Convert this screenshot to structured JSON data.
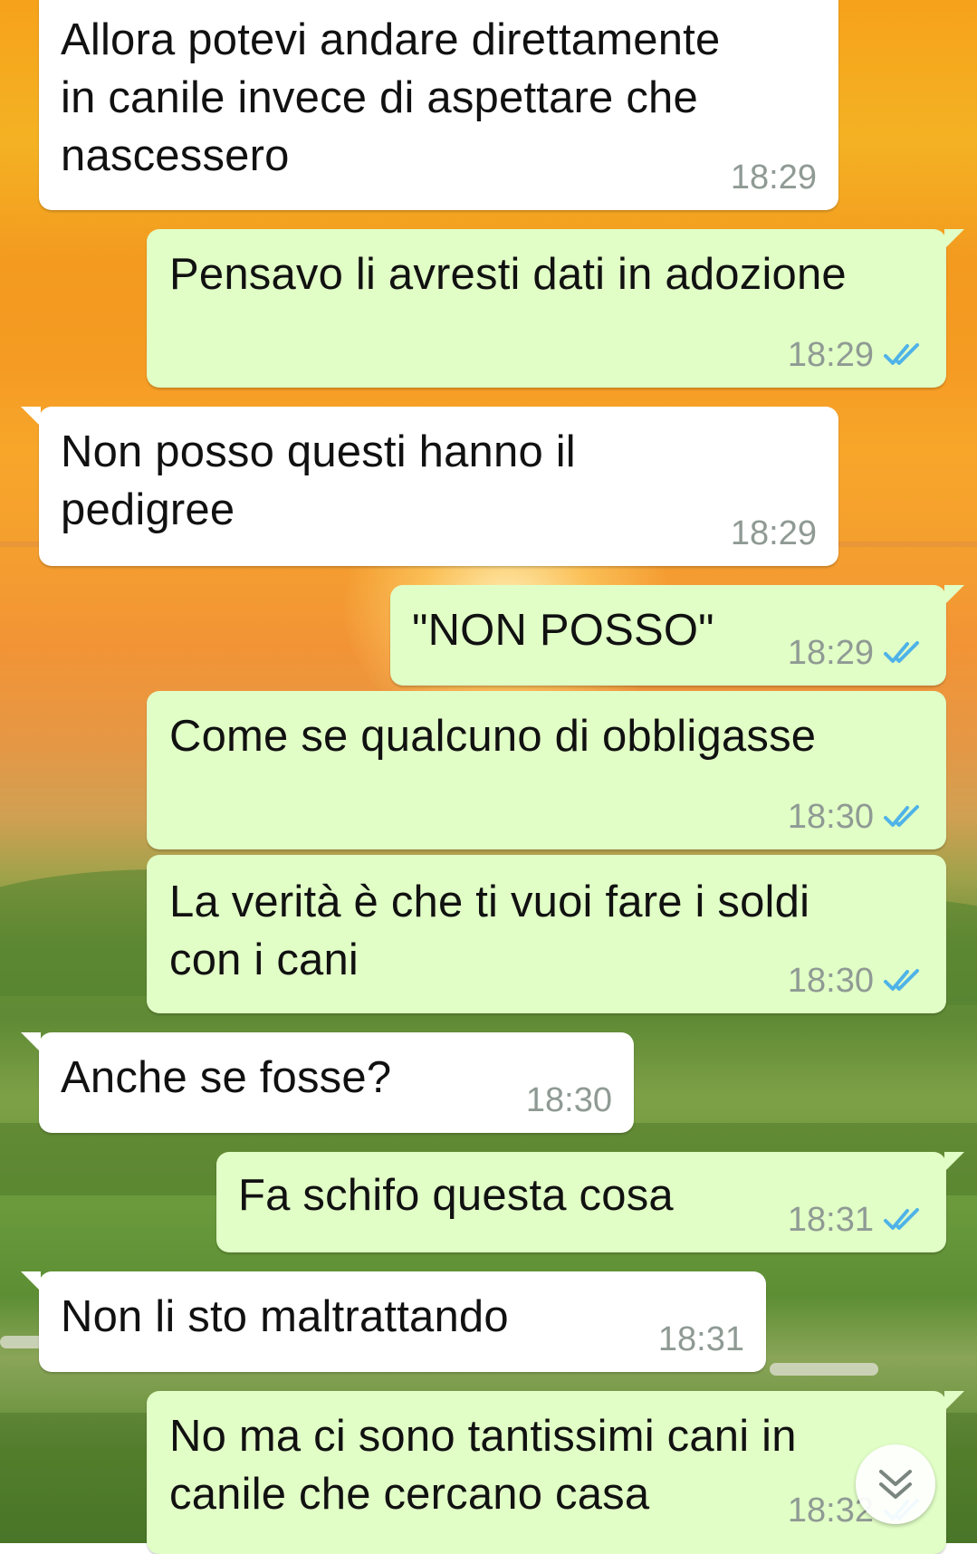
{
  "conversation": {
    "messages": [
      {
        "direction": "incoming",
        "text": "Allora potevi andare direttamente\nin canile invece di aspettare che\nnascessero",
        "time": "18:29"
      },
      {
        "direction": "outgoing",
        "text": "Pensavo li avresti dati in adozione",
        "time": "18:29",
        "status": "read"
      },
      {
        "direction": "incoming",
        "text": "Non posso questi hanno il\npedigree",
        "time": "18:29"
      },
      {
        "direction": "outgoing",
        "text": "\"NON POSSO\"",
        "time": "18:29",
        "status": "read"
      },
      {
        "direction": "outgoing",
        "text": "Come se qualcuno di obbligasse",
        "time": "18:30",
        "status": "read"
      },
      {
        "direction": "outgoing",
        "text": "La verità è che ti vuoi fare i soldi\ncon i cani",
        "time": "18:30",
        "status": "read"
      },
      {
        "direction": "incoming",
        "text": "Anche se fosse?",
        "time": "18:30"
      },
      {
        "direction": "outgoing",
        "text": "Fa schifo questa cosa",
        "time": "18:31",
        "status": "read"
      },
      {
        "direction": "incoming",
        "text": "Non li sto maltrattando",
        "time": "18:31"
      },
      {
        "direction": "outgoing",
        "text": "No ma ci sono tantissimi cani in\ncanile che cercano casa",
        "time": "18:32",
        "status": "read"
      }
    ]
  },
  "colors": {
    "incoming_bubble": "#ffffff",
    "outgoing_bubble": "#e1fec6",
    "read_ticks": "#4fb3e8",
    "timestamp": "#8f9a94"
  },
  "icons": {
    "read_status": "double-check-icon",
    "scroll_down": "double-chevron-down-icon"
  }
}
